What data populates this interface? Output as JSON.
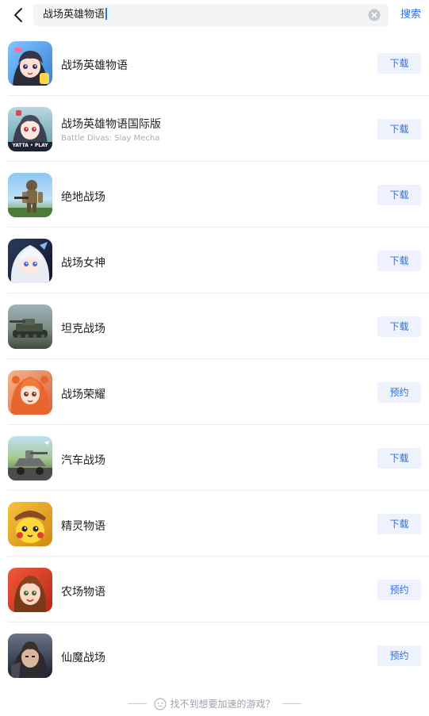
{
  "search": {
    "query": "战场英雄物语",
    "button_label": "搜索"
  },
  "games": [
    {
      "name": "战场英雄物语",
      "subtitle": "",
      "action": "下载",
      "icon": "anime-girl-game-icon"
    },
    {
      "name": "战场英雄物语国际版",
      "subtitle": "Battle Divas: Slay Mecha",
      "action": "下载",
      "icon": "anime-girl-yatta-play-icon",
      "badge": "YATTA • PLAY"
    },
    {
      "name": "绝地战场",
      "subtitle": "",
      "action": "下载",
      "icon": "parachute-soldier-icon"
    },
    {
      "name": "战场女神",
      "subtitle": "",
      "action": "下载",
      "icon": "white-hair-girl-icon"
    },
    {
      "name": "坦克战场",
      "subtitle": "",
      "action": "下载",
      "icon": "tank-icon"
    },
    {
      "name": "战场荣耀",
      "subtitle": "",
      "action": "预约",
      "icon": "orange-hair-girl-icon"
    },
    {
      "name": "汽车战场",
      "subtitle": "",
      "action": "下载",
      "icon": "car-battle-icon"
    },
    {
      "name": "精灵物语",
      "subtitle": "",
      "action": "下载",
      "icon": "pikachu-detective-icon"
    },
    {
      "name": "农场物语",
      "subtitle": "",
      "action": "预约",
      "icon": "farm-girl-icon"
    },
    {
      "name": "仙魔战场",
      "subtitle": "",
      "action": "预约",
      "icon": "dark-warrior-icon"
    }
  ],
  "footer": {
    "text": "找不到想要加速的游戏？"
  },
  "colors": {
    "accent": "#2f6fe4",
    "button_bg": "#eef2fc"
  }
}
